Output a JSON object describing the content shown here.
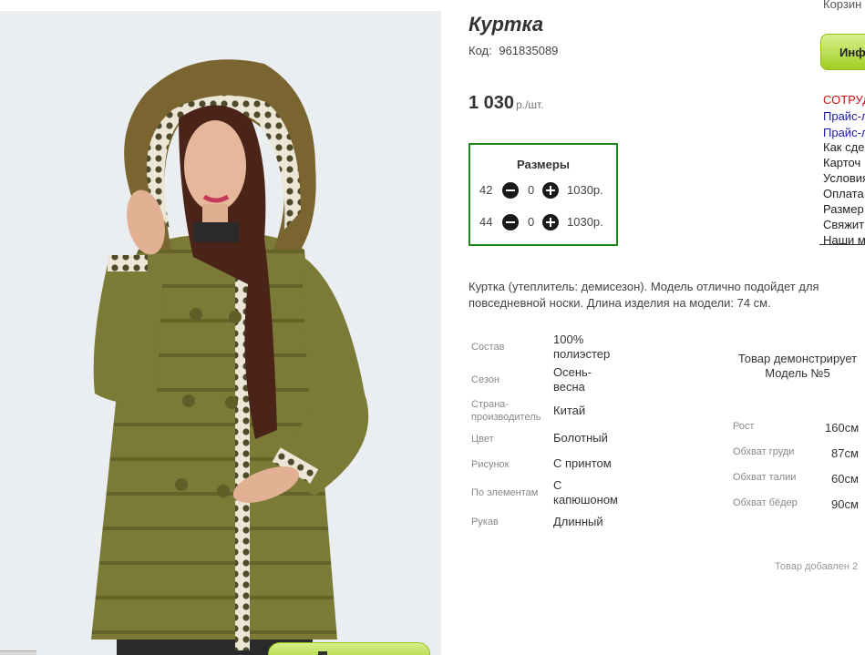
{
  "product": {
    "title": "Куртка",
    "code_label": "Код:",
    "code": "961835089",
    "price": "1 030",
    "price_unit": "р./шт."
  },
  "sizes": {
    "heading": "Размеры",
    "rows": [
      {
        "size": "42",
        "qty": "0",
        "price": "1030р."
      },
      {
        "size": "44",
        "qty": "0",
        "price": "1030р."
      }
    ]
  },
  "description": "Куртка (утеплитель: демисезон). Модель отлично подойдет для повседневной носки. Длина изделия на модели: 74 см.",
  "specs": [
    {
      "label": "Состав",
      "value": "100% полиэстер"
    },
    {
      "label": "Сезон",
      "value": "Осень-весна"
    },
    {
      "label": "Страна-производитель",
      "value": "Китай"
    },
    {
      "label": "Цвет",
      "value": "Болотный"
    },
    {
      "label": "Рисунок",
      "value": "С принтом"
    },
    {
      "label": "По элементам",
      "value": "С капюшоном"
    },
    {
      "label": "Рукав",
      "value": "Длинный"
    }
  ],
  "model": {
    "caption": "Товар демонстрирует Модель №5",
    "measures": [
      {
        "label": "Рост",
        "value": "160см"
      },
      {
        "label": "Обхват груди",
        "value": "87см"
      },
      {
        "label": "Обхват талии",
        "value": "60см"
      },
      {
        "label": "Обхват бёдер",
        "value": "90см"
      }
    ],
    "added": "Товар добавлен 2"
  },
  "sidebar": {
    "cart": "Корзин",
    "info_button": "Инф",
    "links": [
      {
        "label": "СОТРУД",
        "color": "red"
      },
      {
        "label": "Прайс-л",
        "color": "blue"
      },
      {
        "label": "Прайс-л",
        "color": "blue"
      },
      {
        "label": "Как сде",
        "color": "black"
      },
      {
        "label": "Карточ",
        "color": "black"
      },
      {
        "label": "Условия",
        "color": "black"
      },
      {
        "label": "Оплата",
        "color": "black"
      },
      {
        "label": "Размер",
        "color": "black"
      },
      {
        "label": "Свяжит",
        "color": "black"
      },
      {
        "label": "Наши м",
        "color": "black"
      }
    ]
  },
  "colors": {
    "size_box_border": "#1c8b1c",
    "button_green": "#a3d12a",
    "link_red": "#d01010",
    "link_blue": "#1a1aa6",
    "jacket": "#7a7a36"
  }
}
